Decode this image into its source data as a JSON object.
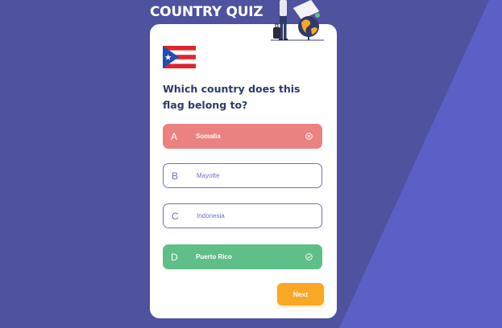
{
  "app": {
    "title": "COUNTRY QUIZ"
  },
  "question": {
    "flag": "Puerto Rico flag",
    "text": "Which country does this flag belong to?"
  },
  "options": [
    {
      "letter": "A",
      "label": "Somalia",
      "state": "wrong",
      "icon": "x-circle-icon"
    },
    {
      "letter": "B",
      "label": "Mayotte",
      "state": "default"
    },
    {
      "letter": "C",
      "label": "Indonesia",
      "state": "default"
    },
    {
      "letter": "D",
      "label": "Puerto Rico",
      "state": "correct",
      "icon": "check-circle-icon"
    }
  ],
  "actions": {
    "next_label": "Next"
  },
  "colors": {
    "background": "#4f529f",
    "background_accent": "#5b5fc6",
    "wrong": "#ea8282",
    "correct": "#60bf88",
    "option_outline": "#6c71c4",
    "next_button": "#f9a826",
    "question_text": "#2f3a6b"
  }
}
